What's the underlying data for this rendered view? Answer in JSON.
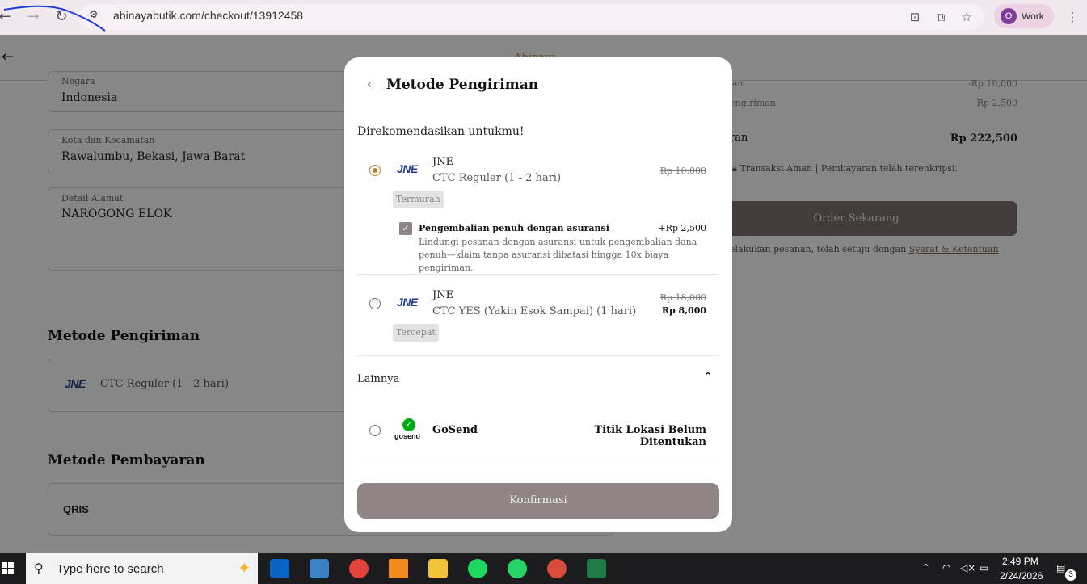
{
  "browser": {
    "url": "abinayabutik.com/checkout/13912458",
    "profile_initial": "O",
    "profile_label": "Work",
    "back_icon": "←",
    "forward_icon": "→",
    "reload_icon": "↻",
    "menu_icon": "⋮"
  },
  "page": {
    "brand": "Abinaya",
    "fields": [
      {
        "label": "Negara",
        "value": "Indonesia"
      },
      {
        "label": "Kota dan Kecamatan",
        "value": "Rawalumbu, Bekasi, Jawa Barat"
      },
      {
        "label": "Detail Alamat",
        "value": "NAROGONG ELOK"
      }
    ],
    "shipping_section_title": "Metode Pengiriman",
    "shipping_selected_logo": "JNE",
    "shipping_selected_service": "CTC Reguler (1 - 2 hari)",
    "payment_section_title": "Metode Pembayaran",
    "payment_logo": "QRIS",
    "summary": {
      "row1_label": "an",
      "row1_value": "-Rp 10,000",
      "row2_label": "engiriman",
      "row2_value": "Rp 2,500",
      "total_label": "ran",
      "total_value": "Rp 222,500",
      "secure_text": "Transaksi Aman | Pembayaran telah terenkripsi.",
      "order_button": "Order Sekarang",
      "terms_prefix": "elakukan pesanan, telah setuju dengan",
      "terms_link": "Syarat & Ketentuan"
    }
  },
  "modal": {
    "title": "Metode Pengiriman",
    "recommended_title": "Direkomendasikan untukmu!",
    "options": [
      {
        "courier": "JNE",
        "logo": "JNE",
        "service": "CTC Reguler (1 - 2 hari)",
        "price_old": "Rp 10,000",
        "badge": "Termurah",
        "selected": true
      },
      {
        "courier": "JNE",
        "logo": "JNE",
        "service": "CTC YES (Yakin Esok Sampai) (1 hari)",
        "price_old": "Rp 18,000",
        "price_new": "Rp 8,000",
        "badge": "Tercepat",
        "selected": false
      }
    ],
    "insurance": {
      "checked": true,
      "title": "Pengembalian penuh dengan asuransi",
      "price": "+Rp 2,500",
      "description": "Lindungi pesanan dengan asuransi untuk pengembalian dana penuh—klaim tanpa asuransi dibatasi hingga 10x biaya pengiriman."
    },
    "others_label": "Lainnya",
    "gosend": {
      "logo_text": "gosend",
      "name": "GoSend",
      "status": "Titik Lokasi Belum Ditentukan"
    },
    "confirm_button": "Konfirmasi"
  },
  "taskbar": {
    "search_placeholder": "Type here to search",
    "time": "2:49 PM",
    "date": "2/24/2026",
    "notification_count": "3",
    "apps": [
      "outlook-icon",
      "store-icon",
      "chrome-icon",
      "vlc-icon",
      "file-explorer-icon",
      "spotify-icon",
      "whatsapp-icon",
      "chrome-profile-icon",
      "excel-icon"
    ]
  },
  "colors": {
    "accent_radio": "#c27b2e",
    "button_muted": "#8f8585",
    "jne_blue": "#1d3f8f",
    "gosend_green": "#00aa13"
  }
}
